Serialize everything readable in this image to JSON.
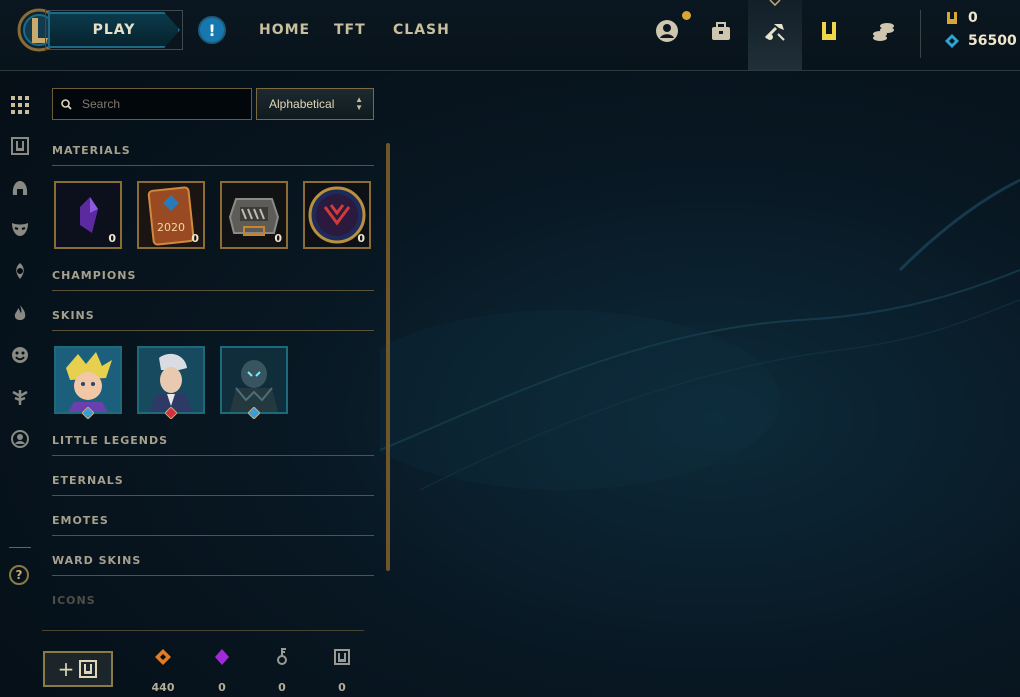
{
  "topbar": {
    "play_label": "PLAY",
    "alert_icon": "exclamation-icon",
    "nav": [
      {
        "label": "HOME"
      },
      {
        "label": "TFT"
      },
      {
        "label": "CLASH"
      }
    ],
    "icons": [
      "profile-icon",
      "collection-bag-icon",
      "crafting-icon",
      "loot-icon",
      "store-icon"
    ],
    "currency": {
      "riot_points": "0",
      "blue_essence": "56500"
    }
  },
  "rail": {
    "icons": [
      "grid-icon",
      "chest-icon",
      "helmet-icon",
      "mask-icon",
      "gem-icon",
      "fire-icon",
      "emote-icon",
      "ward-icon",
      "summoner-icon",
      "help-icon"
    ],
    "help_label": "?"
  },
  "panel": {
    "search_placeholder": "Search",
    "sort_label": "Alphabetical",
    "sections": {
      "materials": "MATERIALS",
      "champions": "CHAMPIONS",
      "skins": "SKINS",
      "little_legends": "LITTLE LEGENDS",
      "eternals": "ETERNALS",
      "emotes": "EMOTES",
      "ward_skins": "WARD SKINS",
      "icons": "ICONS"
    },
    "materials": [
      {
        "name": "dark-shard-icon",
        "count": "0"
      },
      {
        "name": "2020-capsule-icon",
        "count": "0"
      },
      {
        "name": "chest-icon",
        "count": "0"
      },
      {
        "name": "event-token-icon",
        "count": "0"
      }
    ],
    "skins": [
      {
        "name": "skin-1",
        "rarity": "blue"
      },
      {
        "name": "skin-2",
        "rarity": "red"
      },
      {
        "name": "skin-3",
        "rarity": "blue"
      }
    ]
  },
  "footer": {
    "add_label": "+",
    "counts": [
      {
        "icon": "orange-essence-icon",
        "value": "440"
      },
      {
        "icon": "mythic-essence-icon",
        "value": "0"
      },
      {
        "icon": "key-icon",
        "value": "0"
      },
      {
        "icon": "chest-icon",
        "value": "0"
      }
    ]
  }
}
